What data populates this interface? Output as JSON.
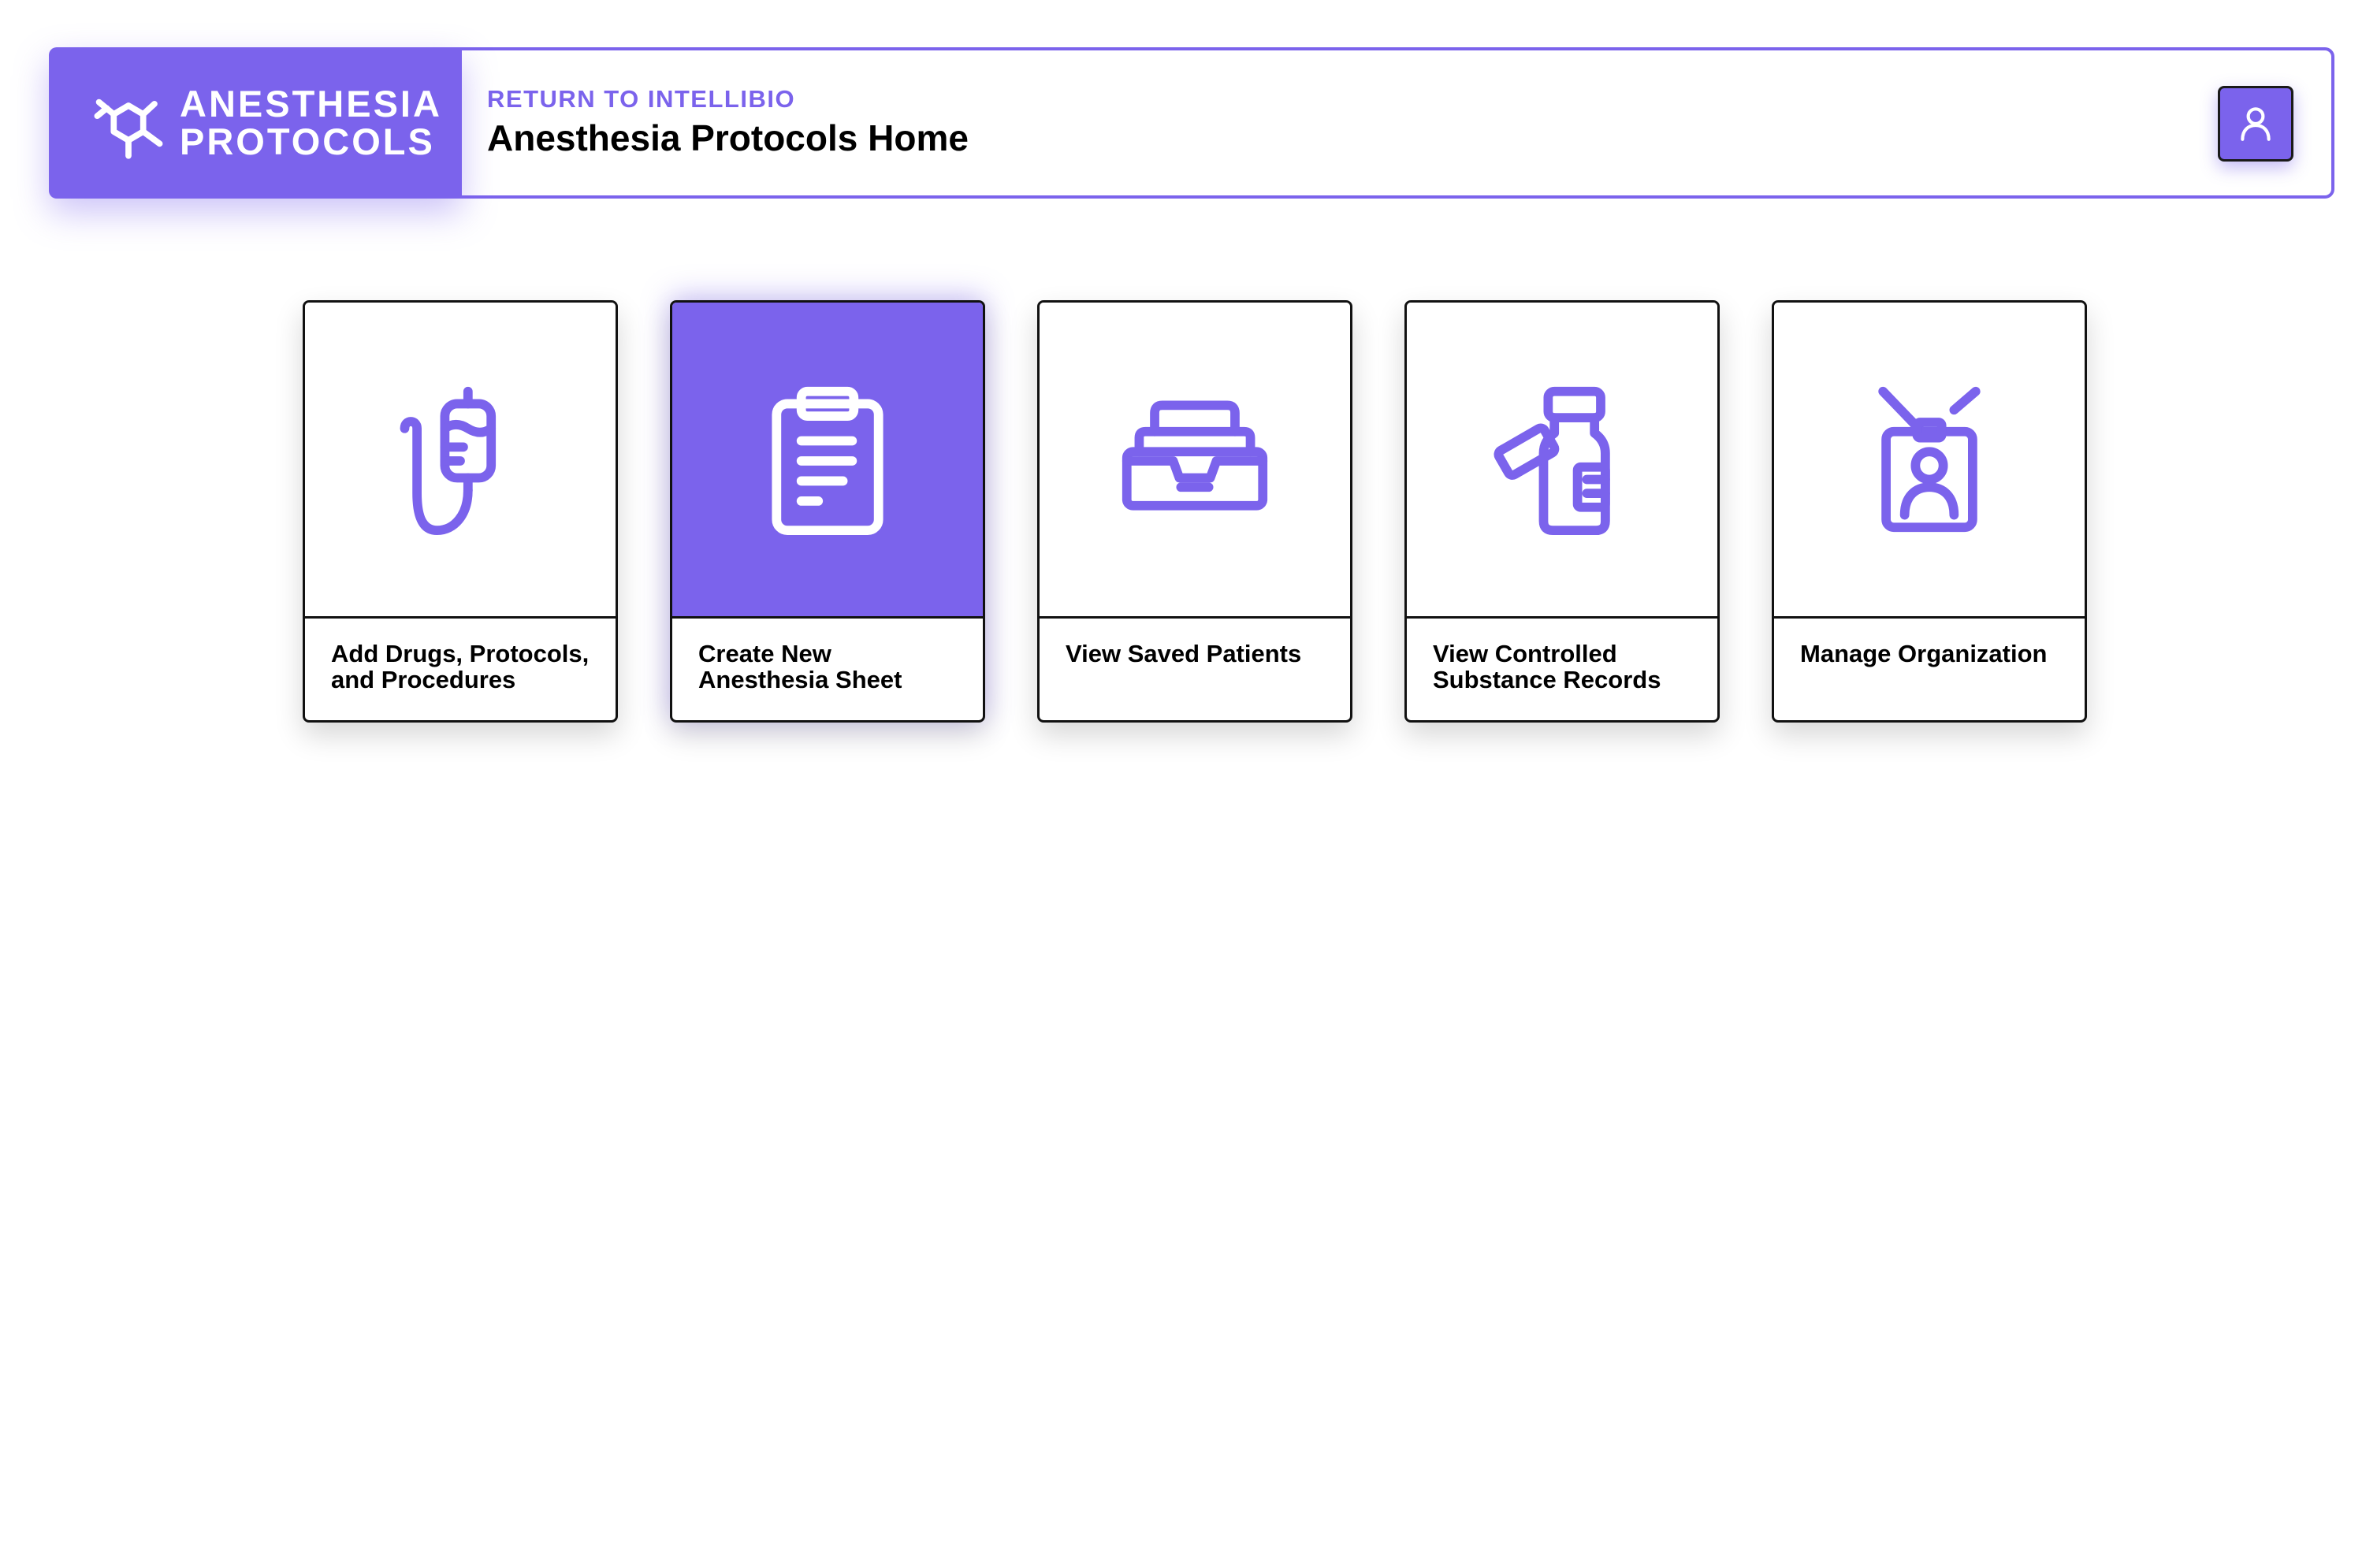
{
  "header": {
    "brand_line1": "ANESTHESIA",
    "brand_line2": "PROTOCOLS",
    "brand_icon": "molecule-icon",
    "return_label": "RETURN TO INTELLIBIO",
    "page_title": "Anesthesia Protocols Home",
    "profile_icon": "user-icon"
  },
  "cards": [
    {
      "label": "Add Drugs, Protocols, and Procedures",
      "icon": "iv-bag-icon",
      "active": false
    },
    {
      "label": "Create New Anesthesia Sheet",
      "icon": "clipboard-icon",
      "active": true
    },
    {
      "label": "View Saved Patients",
      "icon": "inbox-tray-icon",
      "active": false
    },
    {
      "label": "View Controlled Substance Records",
      "icon": "medicine-bottle-icon",
      "active": false
    },
    {
      "label": "Manage Organization",
      "icon": "id-badge-icon",
      "active": false
    }
  ],
  "colors": {
    "accent": "#7b63ec",
    "border": "#111111",
    "background": "#ffffff"
  }
}
